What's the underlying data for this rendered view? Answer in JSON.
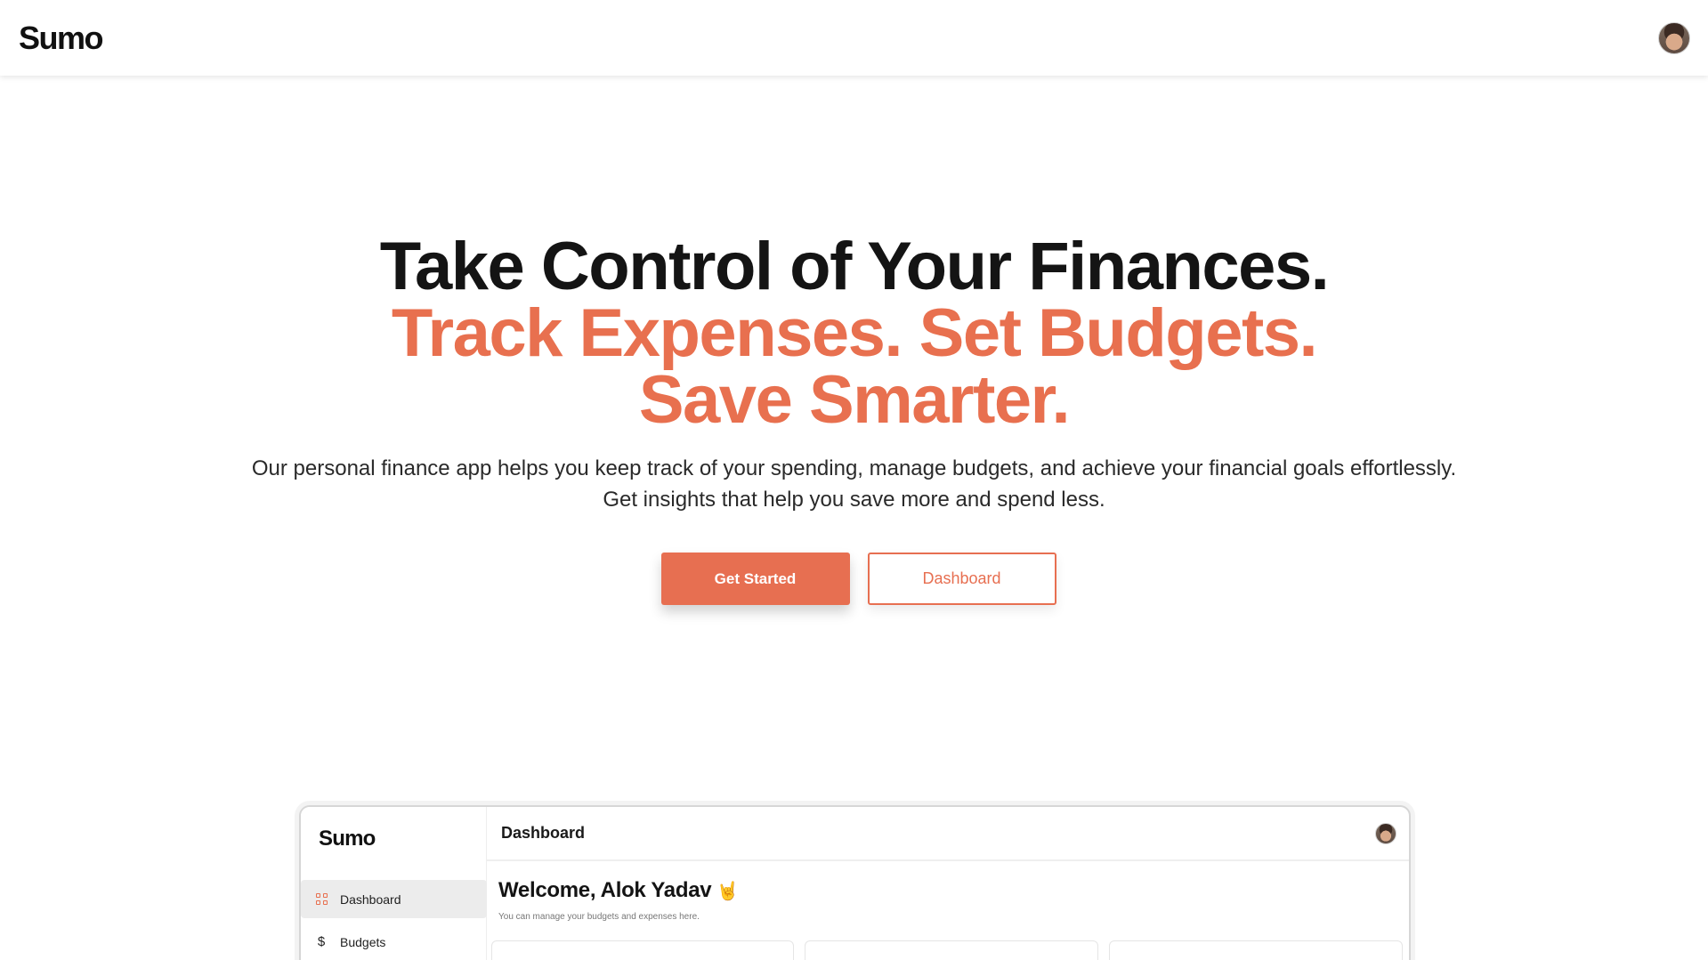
{
  "nav": {
    "logo": "Sumo",
    "avatar_icon": "user-avatar"
  },
  "hero": {
    "headline": "Take Control of Your Finances.",
    "accent_headline": "Track Expenses. Set Budgets. Save Smarter.",
    "subtitle_line1": "Our personal finance app helps you keep track of your spending, manage budgets, and achieve your financial goals effortlessly.",
    "subtitle_line2": "Get insights that help you save more and spend less.",
    "primary_cta": "Get Started",
    "secondary_cta": "Dashboard"
  },
  "preview": {
    "logo": "Sumo",
    "header_title": "Dashboard",
    "sidebar": [
      {
        "label": "Dashboard",
        "icon": "grid-icon",
        "active": true
      },
      {
        "label": "Budgets",
        "icon": "dollar-icon",
        "active": false
      }
    ],
    "welcome": "Welcome, Alok Yadav",
    "welcome_emoji": "🤘",
    "welcome_sub": "You can manage your budgets and expenses here."
  },
  "colors": {
    "accent": "#e76f51",
    "text": "#141414"
  }
}
